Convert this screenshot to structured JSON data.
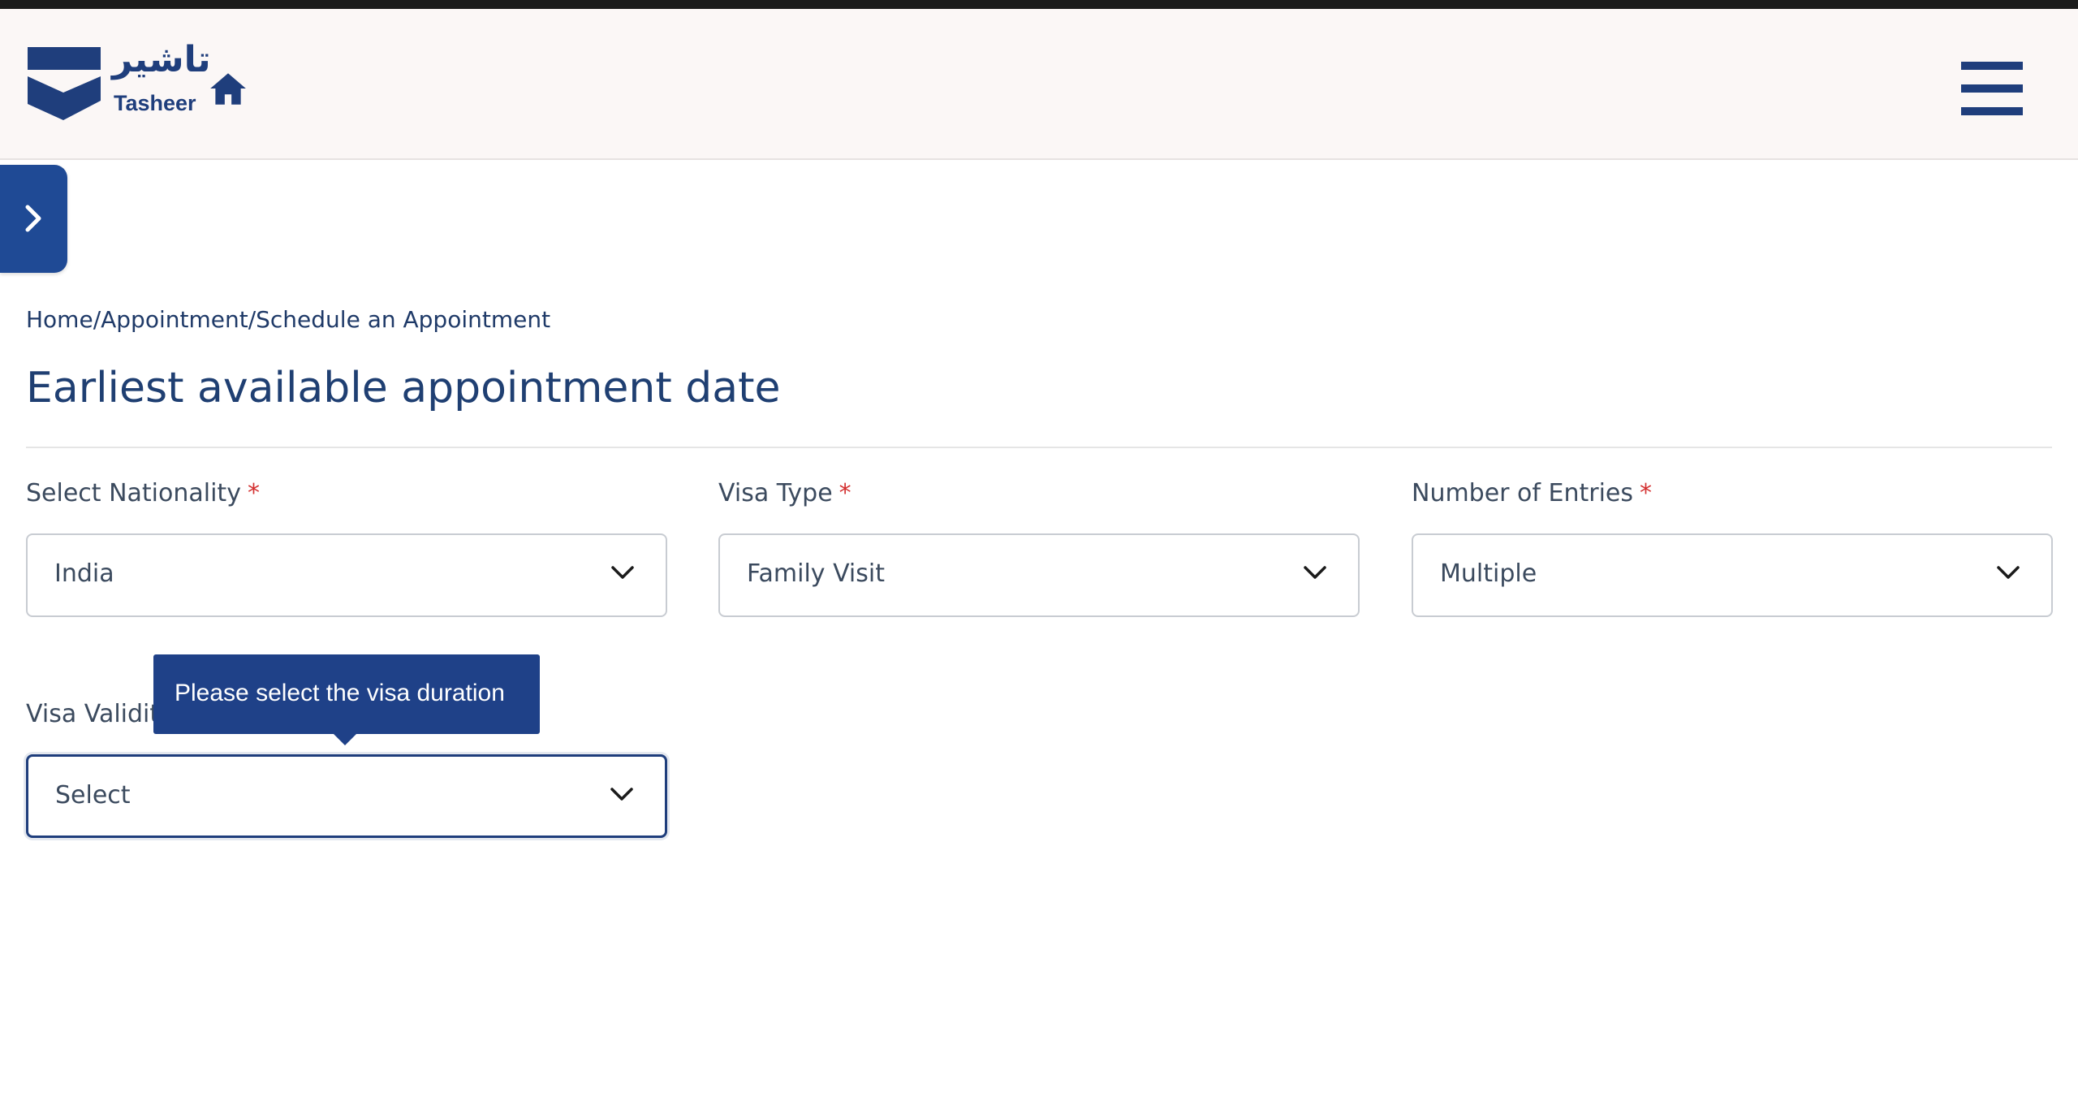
{
  "header": {
    "logo_arabic": "تاشير",
    "logo_latin": "Tasheer",
    "home_icon": "home-icon",
    "menu_icon": "hamburger-menu-icon"
  },
  "sidebar_toggle": {
    "icon": "chevron-right-icon"
  },
  "breadcrumb": {
    "items": [
      "Home",
      "Appointment",
      "Schedule an Appointment"
    ],
    "separator": "/"
  },
  "page": {
    "title": "Earliest available appointment date"
  },
  "form": {
    "nationality": {
      "label": "Select Nationality",
      "required_mark": "*",
      "value": "India"
    },
    "visa_type": {
      "label": "Visa Type",
      "required_mark": "*",
      "value": "Family Visit"
    },
    "entries": {
      "label": "Number of Entries",
      "required_mark": "*",
      "value": "Multiple"
    },
    "visa_validity": {
      "label": "Visa Validity",
      "value": "Select",
      "tooltip": "Please select the visa duration"
    }
  },
  "colors": {
    "brand_blue": "#1f4188",
    "required_red": "#d32f2f",
    "header_bg": "#fbf7f6"
  }
}
